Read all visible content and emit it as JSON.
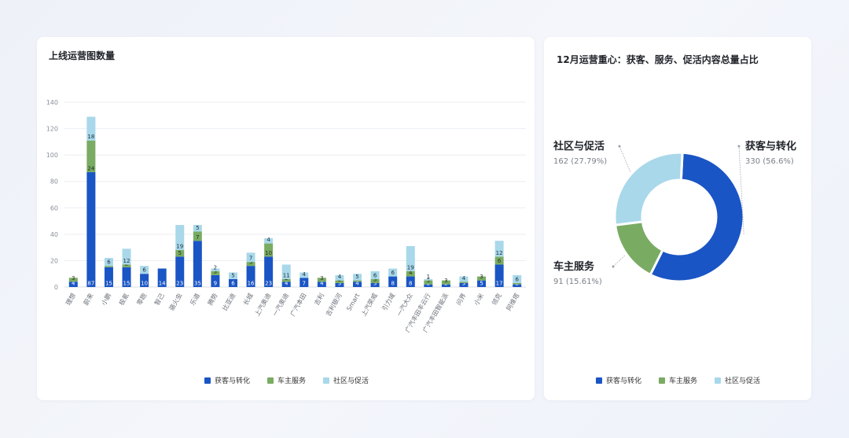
{
  "left_panel": {
    "title": "上线运营图数量"
  },
  "right_panel": {
    "title": "12月运营重心：获客、服务、促活内容总量占比"
  },
  "colors": {
    "series_1": "#1a55c5",
    "series_2": "#7aab63",
    "series_3": "#a8d8ea"
  },
  "chart_data": [
    {
      "type": "bar",
      "stacked": true,
      "title": "上线运营图数量",
      "categories": [
        "理想",
        "蔚来",
        "小鹏",
        "极氪",
        "零跑",
        "智己",
        "骆火虫",
        "乐道",
        "腾势",
        "比亚迪",
        "长城",
        "上汽奥迪",
        "一汽奥迪",
        "广汽本田",
        "吉利",
        "吉利银河",
        "Smart",
        "上汽荣威",
        "引力域",
        "一汽大众",
        "广汽丰田丰云行",
        "广汽丰田智能派",
        "问界",
        "小米",
        "领克",
        "阿维塔"
      ],
      "series": [
        {
          "name": "获客与转化",
          "values": [
            4,
            87,
            15,
            15,
            10,
            14,
            23,
            35,
            9,
            6,
            16,
            23,
            4,
            7,
            4,
            3,
            4,
            3,
            8,
            8,
            2,
            2,
            3,
            5,
            17,
            2
          ]
        },
        {
          "name": "车主服务",
          "values": [
            3,
            24,
            1,
            2,
            0,
            0,
            5,
            7,
            3,
            0,
            3,
            10,
            2,
            0,
            3,
            2,
            1,
            3,
            0,
            4,
            3,
            3,
            1,
            3,
            6,
            1
          ]
        },
        {
          "name": "社区与促活",
          "values": [
            0,
            18,
            6,
            12,
            6,
            0,
            19,
            5,
            2,
            5,
            7,
            4,
            11,
            4,
            0,
            4,
            5,
            6,
            6,
            19,
            1,
            0,
            4,
            0,
            12,
            6
          ]
        }
      ],
      "ylim": [
        0,
        140
      ],
      "yticks": [
        0,
        20,
        40,
        60,
        80,
        100,
        120,
        140
      ],
      "xlabel": "",
      "ylabel": "",
      "grid": true,
      "legend_position": "bottom"
    },
    {
      "type": "pie",
      "donut": true,
      "title": "12月运营重心：获客、服务、促活内容总量占比",
      "series": [
        {
          "name": "获客与转化",
          "value": 330,
          "label": "330 (56.6%)"
        },
        {
          "name": "车主服务",
          "value": 91,
          "label": "91 (15.61%)"
        },
        {
          "name": "社区与促活",
          "value": 162,
          "label": "162 (27.79%)"
        }
      ],
      "legend_position": "bottom"
    }
  ]
}
